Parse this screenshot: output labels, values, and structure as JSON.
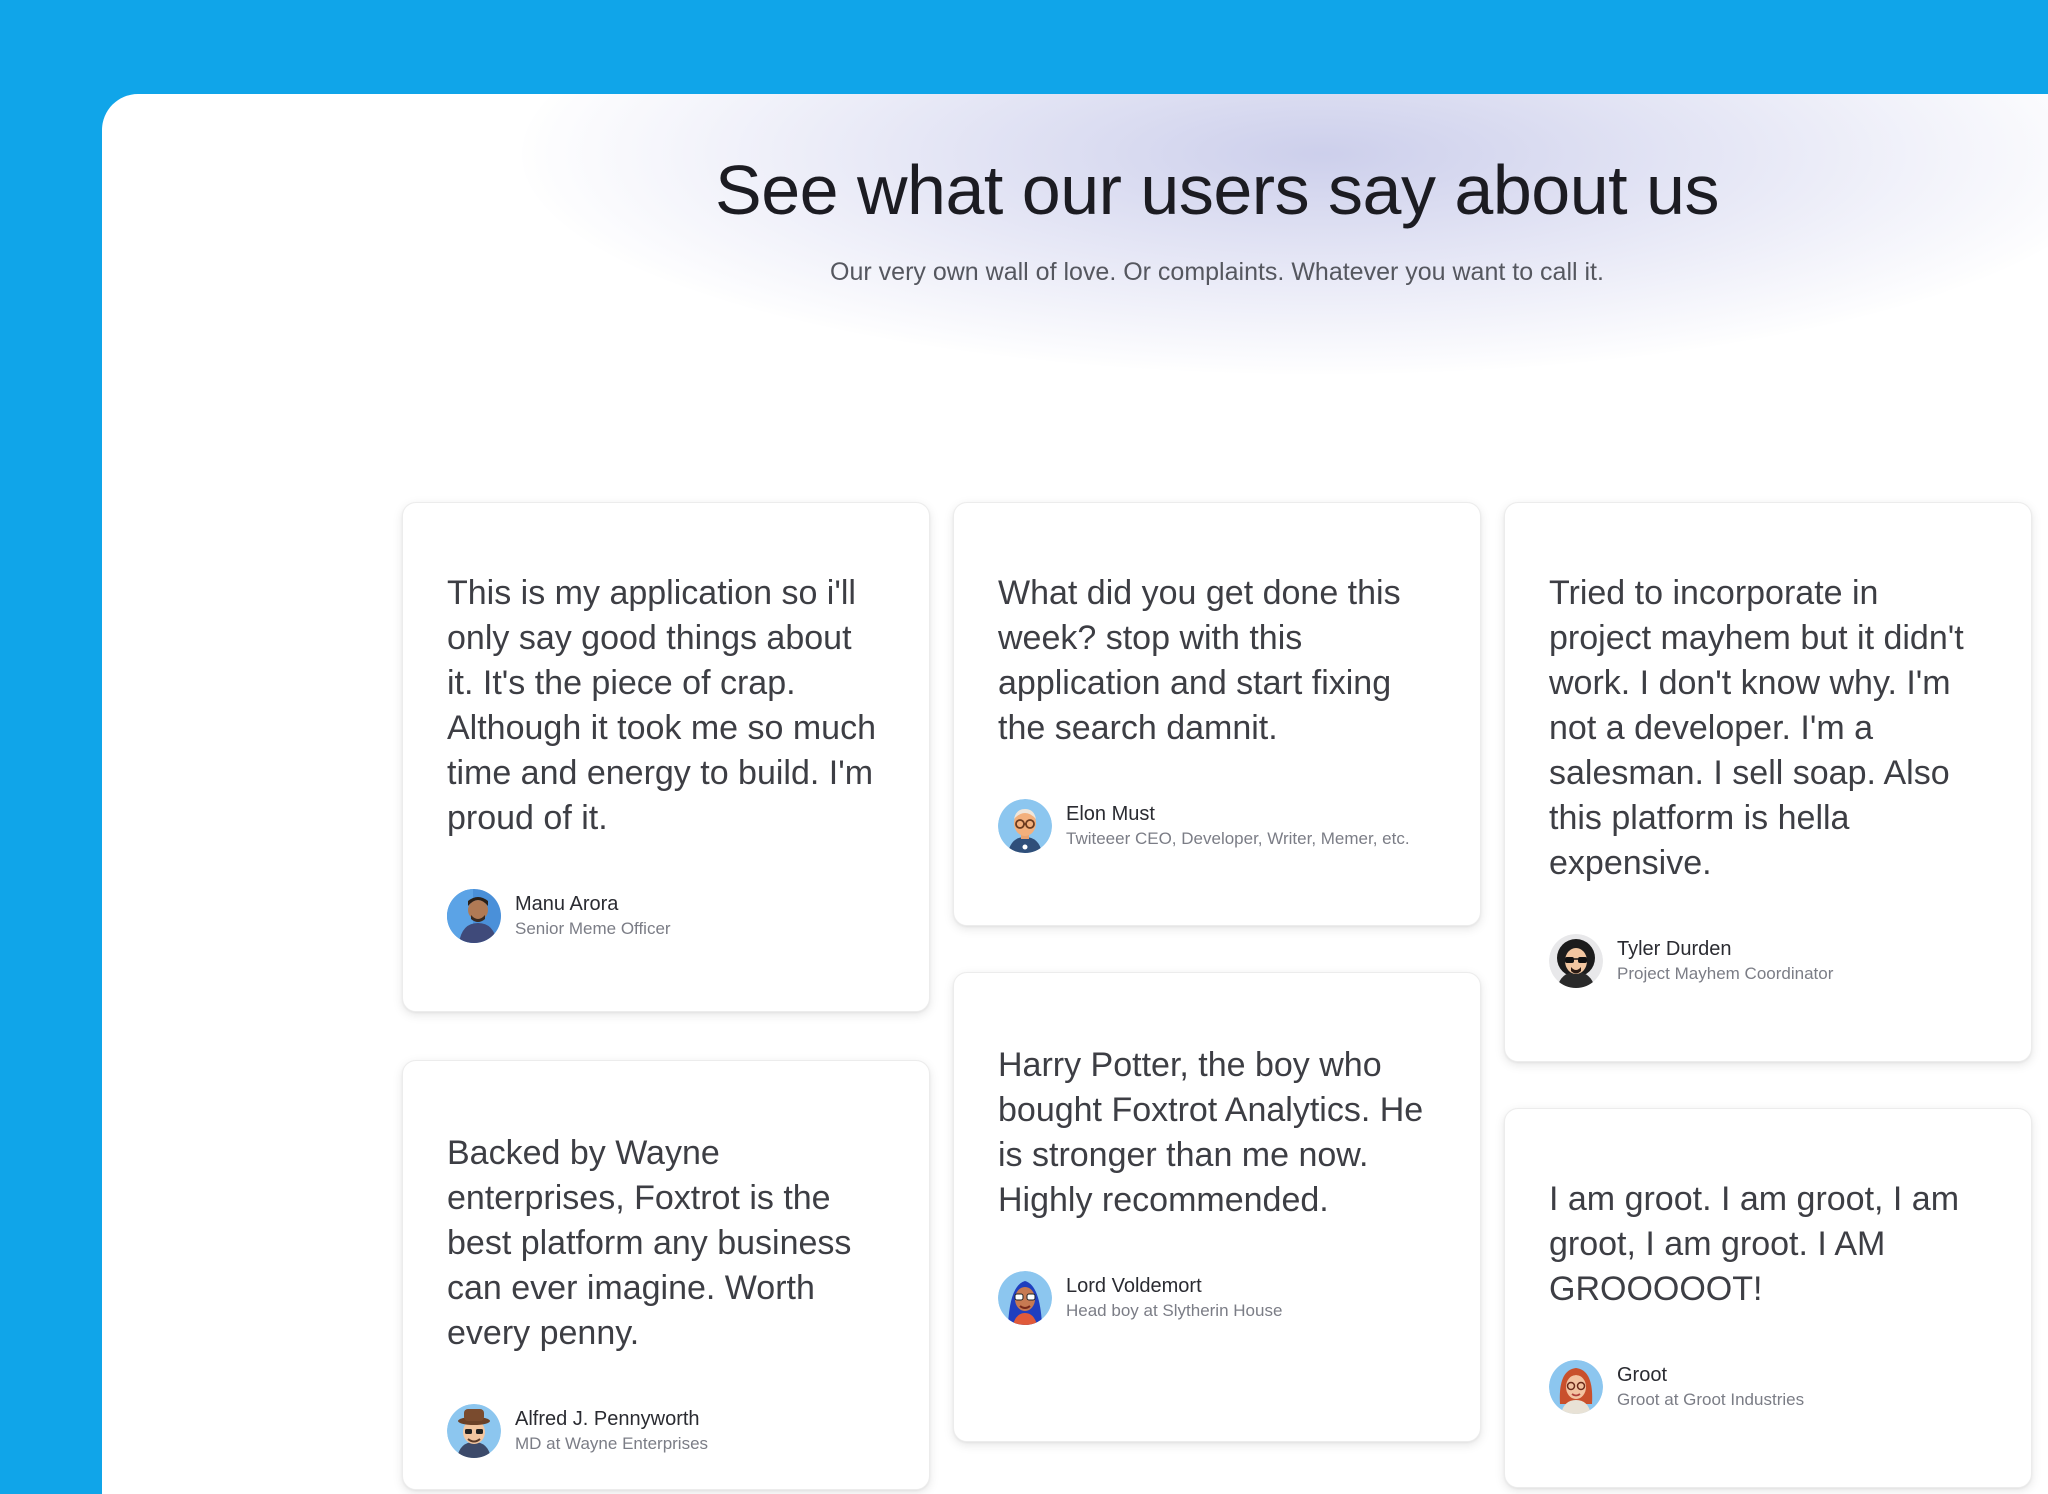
{
  "header": {
    "title": "See what our users say about us",
    "subtitle": "Our very own wall of love. Or complaints. Whatever you want to call it."
  },
  "testimonials": [
    {
      "quote": "This is my application so i'll only say good things about it. It's the piece of crap. Although it took me so much time and energy to build. I'm proud of it.",
      "name": "Manu Arora",
      "role": "Senior Meme Officer",
      "avatar_icon": "man-photo-avatar"
    },
    {
      "quote": "What did you get done this week? stop with this application and start fixing the search damnit.",
      "name": "Elon Must",
      "role": "Twiteeer CEO, Developer, Writer, Memer, etc.",
      "avatar_icon": "bald-man-glasses-avatar"
    },
    {
      "quote": "Tried to incorporate in project mayhem but it didn't work. I don't know why. I'm not a developer. I'm a salesman. I sell soap. Also this platform is hella expensive.",
      "name": "Tyler Durden",
      "role": "Project Mayhem Coordinator",
      "avatar_icon": "sunglasses-man-avatar"
    },
    {
      "quote": "Backed by Wayne enterprises, Foxtrot is the best platform any business can ever imagine. Worth every penny.",
      "name": "Alfred J. Pennyworth",
      "role": "MD at Wayne Enterprises",
      "avatar_icon": "hat-man-avatar"
    },
    {
      "quote": "Harry Potter, the boy who bought Foxtrot Analytics. He is stronger than me now. Highly recommended.",
      "name": "Lord Voldemort",
      "role": "Head boy at Slytherin House",
      "avatar_icon": "blue-hair-glasses-avatar"
    },
    {
      "quote": "I am groot. I am groot, I am groot, I am groot. I AM GROOOOOT!",
      "name": "Groot",
      "role": "Groot at Groot Industries",
      "avatar_icon": "red-hair-woman-avatar"
    }
  ],
  "colors": {
    "background": "#10a5e9",
    "panel": "#ffffff",
    "glow": "#c9cbe9",
    "title_text": "#1c1c22",
    "body_text": "#3d3e44",
    "muted_text": "#7b7d86"
  }
}
